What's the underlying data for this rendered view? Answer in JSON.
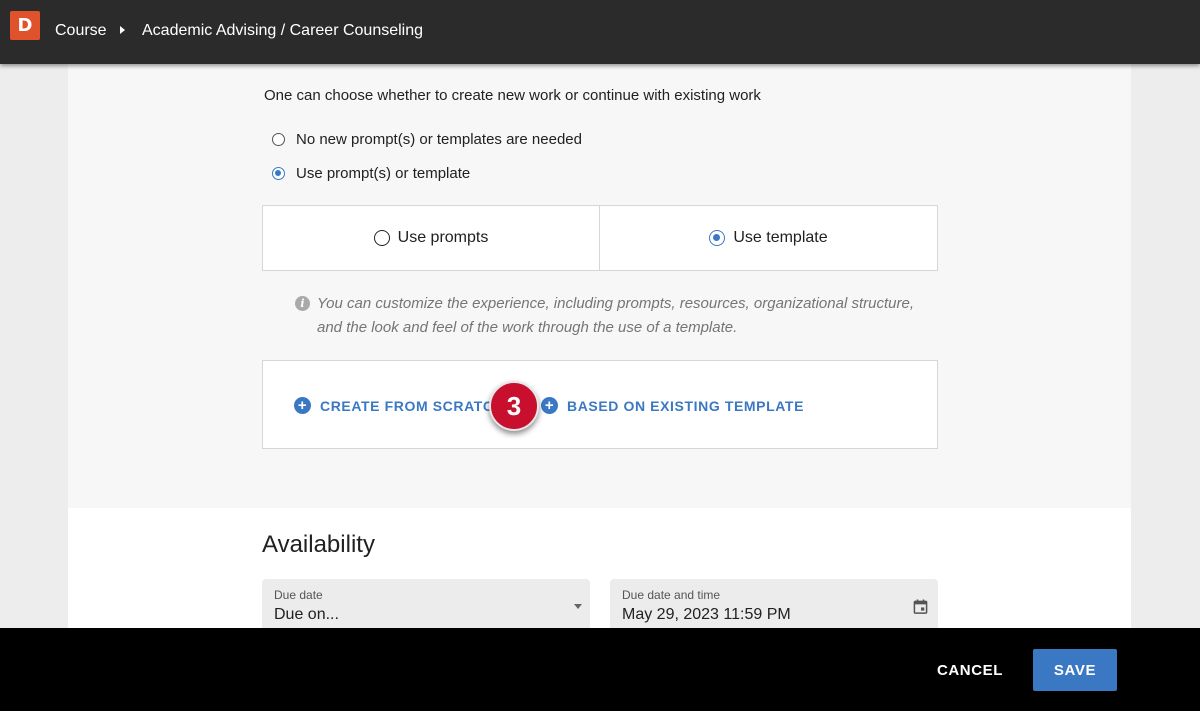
{
  "app": {
    "logo_letter": "D",
    "breadcrumb": {
      "course": "Course",
      "title": "Academic Advising / Career Counseling"
    }
  },
  "work": {
    "intro": "One can choose whether to create new work or continue with existing work",
    "options": [
      {
        "label": "No new prompt(s) or templates are needed",
        "selected": false
      },
      {
        "label": "Use prompt(s) or template",
        "selected": true
      }
    ],
    "mode_choices": [
      {
        "label": "Use prompts",
        "selected": false
      },
      {
        "label": "Use template",
        "selected": true
      }
    ],
    "info_text": "You can customize the experience, including prompts, resources, organizational structure, and the look and feel of the work through the use of a template.",
    "create_from_scratch": "CREATE FROM SCRATCH",
    "based_on_existing": "BASED ON EXISTING TEMPLATE",
    "step_badge": "3"
  },
  "availability": {
    "title": "Availability",
    "due_date": {
      "label": "Due date",
      "value": "Due on..."
    },
    "due_datetime": {
      "label": "Due date and time",
      "value": "May 29, 2023 11:59 PM"
    }
  },
  "footer": {
    "cancel": "CANCEL",
    "save": "SAVE"
  },
  "colors": {
    "accent": "#3b78c4",
    "brand": "#e0522c",
    "badge": "#c8102e"
  }
}
